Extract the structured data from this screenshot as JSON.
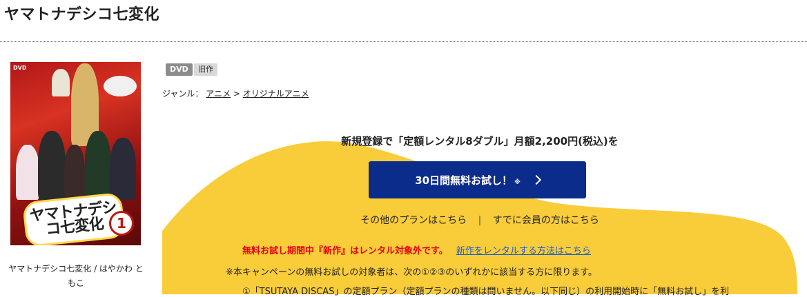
{
  "page": {
    "title": "ヤマトナデシコ七変化"
  },
  "product": {
    "cover_dvd_mark": "DVD",
    "cover_logo_text": "ヤマトナデシコ七変化",
    "cover_volume": "1",
    "caption": "ヤマトナデシコ七変化 / はやかわ ともこ",
    "badges": [
      "DVD",
      "旧作"
    ],
    "genre_label": "ジャンル：",
    "genre_path": [
      "アニメ",
      "オリジナルアニメ"
    ],
    "genre_separator": ">"
  },
  "promo": {
    "headline": "新規登録で「定額レンタル8ダブル」月額2,200円(税込)を",
    "button_label": "30日間無料お試し！",
    "button_note": "※",
    "other_plans_link": "その他のプランはこちら",
    "link_separator": "|",
    "member_link": "すでに会員の方はこちら",
    "warning_text": "無料お試し期間中『新作』はレンタル対象外です。",
    "warning_link": "新作をレンタルする方法はこちら",
    "note_campaign": "※本キャンペーンの無料お試しの対象者は、次の①②③のいずれかに該当する方に限ります。",
    "note_item1": "①「TSUTAYA DISCAS」の定額プラン（定額プランの種類は問いません。以下同じ）の利用開始時に「無料お試し」を利"
  },
  "colors": {
    "promo_yellow": "#f9cc3a",
    "button_navy": "#0c2c8c",
    "warning_red": "#e60012",
    "link_blue": "#1a5ccc"
  }
}
